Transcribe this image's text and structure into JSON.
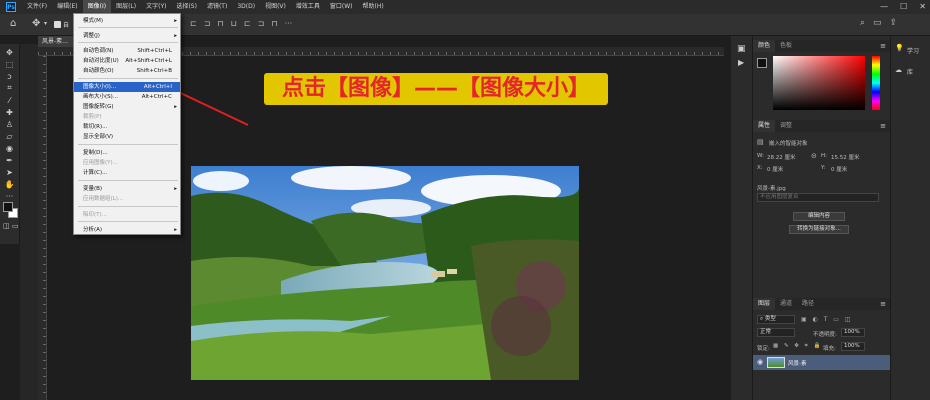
{
  "app": {
    "logo": "Ps"
  },
  "menubar": [
    "文件(F)",
    "编辑(E)",
    "图像(I)",
    "图层(L)",
    "文字(Y)",
    "选择(S)",
    "滤镜(T)",
    "3D(D)",
    "视图(V)",
    "增效工具",
    "窗口(W)",
    "帮助(H)"
  ],
  "window_controls": [
    "—",
    "☐",
    "✕"
  ],
  "optbar_label": "自",
  "document": {
    "tab": "风景-素...",
    "banner": "点击【图像】——【图像大小】"
  },
  "image_menu": {
    "items": [
      {
        "label": "模式(M)",
        "shortcut": "",
        "submenu": true,
        "disabled": false
      },
      {
        "label": "调整(J)",
        "shortcut": "",
        "submenu": true,
        "disabled": false
      },
      {
        "label": "自动色调(N)",
        "shortcut": "Shift+Ctrl+L",
        "submenu": false,
        "disabled": false
      },
      {
        "label": "自动对比度(U)",
        "shortcut": "Alt+Shift+Ctrl+L",
        "submenu": false,
        "disabled": false
      },
      {
        "label": "自动颜色(O)",
        "shortcut": "Shift+Ctrl+B",
        "submenu": false,
        "disabled": false
      },
      {
        "label": "图像大小(I)...",
        "shortcut": "Alt+Ctrl+I",
        "submenu": false,
        "disabled": false,
        "highlighted": true
      },
      {
        "label": "画布大小(S)...",
        "shortcut": "Alt+Ctrl+C",
        "submenu": false,
        "disabled": false
      },
      {
        "label": "图像旋转(G)",
        "shortcut": "",
        "submenu": true,
        "disabled": false
      },
      {
        "label": "裁剪(P)",
        "shortcut": "",
        "submenu": false,
        "disabled": true
      },
      {
        "label": "裁切(R)...",
        "shortcut": "",
        "submenu": false,
        "disabled": false
      },
      {
        "label": "显示全部(V)",
        "shortcut": "",
        "submenu": false,
        "disabled": false
      },
      {
        "label": "复制(D)...",
        "shortcut": "",
        "submenu": false,
        "disabled": false
      },
      {
        "label": "应用图像(Y)...",
        "shortcut": "",
        "submenu": false,
        "disabled": true
      },
      {
        "label": "计算(C)...",
        "shortcut": "",
        "submenu": false,
        "disabled": false
      },
      {
        "label": "变量(B)",
        "shortcut": "",
        "submenu": true,
        "disabled": false
      },
      {
        "label": "应用数据组(L)...",
        "shortcut": "",
        "submenu": false,
        "disabled": true
      },
      {
        "label": "陷印(T)...",
        "shortcut": "",
        "submenu": false,
        "disabled": true
      },
      {
        "label": "分析(A)",
        "shortcut": "",
        "submenu": true,
        "disabled": false
      }
    ]
  },
  "color_panel": {
    "tabs": [
      "颜色",
      "色板"
    ]
  },
  "properties_panel": {
    "tabs": [
      "属性",
      "调整"
    ],
    "type_label": "嵌入的智能对象",
    "w_label": "W:",
    "w_value": "28.22 厘米",
    "h_label": "H:",
    "h_value": "15.52 厘米",
    "x_label": "X:",
    "x_value": "0 厘米",
    "y_label": "Y:",
    "y_value": "0 厘米",
    "file_name": "风景-素.jpg",
    "comp_placeholder": "不应用图层复合",
    "btn_edit": "编辑内容",
    "btn_convert": "转换为链接对象..."
  },
  "layers_panel": {
    "tabs": [
      "图层",
      "通道",
      "路径"
    ],
    "filter_label": "类型",
    "blend_mode": "正常",
    "opacity_label": "不透明度:",
    "opacity_value": "100%",
    "lock_label": "锁定:",
    "fill_label": "填充:",
    "fill_value": "100%",
    "layer_name": "风景-素"
  },
  "learn_panel": {
    "learn": "学习",
    "library": "库"
  },
  "colors": {
    "accent_highlight": "#2a63c8",
    "banner_bg": "#e2c600",
    "banner_text": "#e4262b"
  }
}
